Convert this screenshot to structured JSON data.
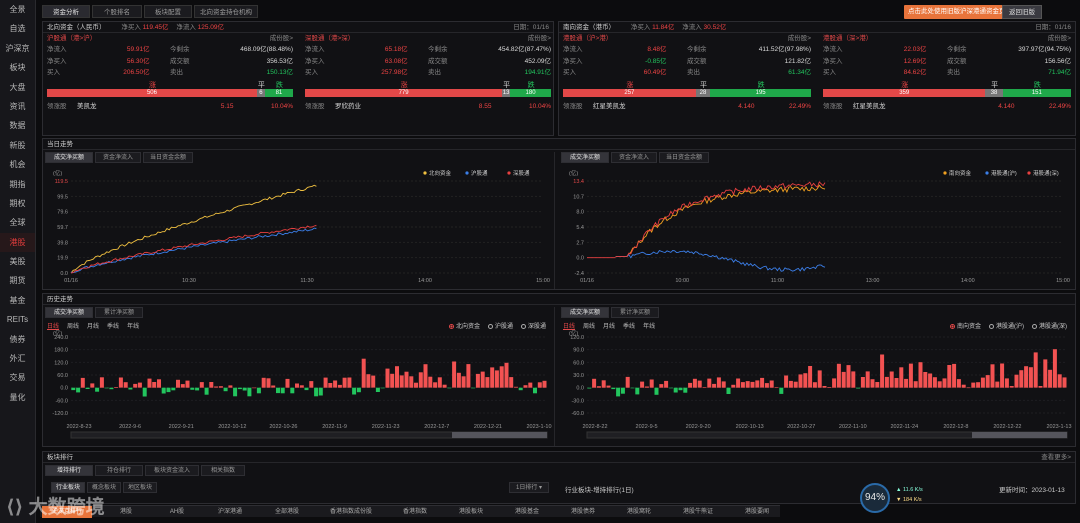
{
  "sidebar": [
    "全景",
    "自选",
    "沪深京",
    "板块",
    "大盘",
    "资讯",
    "数据",
    "新股",
    "机会",
    "期指",
    "期权",
    "全球",
    "港股",
    "美股",
    "期货",
    "基金",
    "REITs",
    "债券",
    "外汇",
    "交易",
    "量化"
  ],
  "sidebar_active": 12,
  "top_tabs": [
    "资金分析",
    "个股排名",
    "板块配置",
    "北向资金持仓机构"
  ],
  "promo": "点击此处使用旧版沪深港通资金页 ×",
  "back": "返回旧版",
  "north": {
    "title": "北向资金（人民币）",
    "net_buy_label": "净买入",
    "net_buy": "119.45亿",
    "net_flow_label": "净流入",
    "net_flow": "125.09亿",
    "date": "日期：01/16",
    "sh": {
      "name": "沪股通（港>沪）",
      "unit": "成份股>",
      "rows": [
        [
          "净流入",
          "59.91亿",
          "今剩余",
          "468.09亿(88.48%)"
        ],
        [
          "净买入",
          "56.30亿",
          "成交额",
          "356.53亿"
        ],
        [
          "买入",
          "206.50亿",
          "卖出",
          "150.13亿"
        ]
      ],
      "up_label": "涨",
      "flat_label": "平",
      "down_label": "跌",
      "up": "506",
      "flat": "6",
      "down": "81",
      "lead_label": "领涨股",
      "lead": "美凯龙",
      "price": "5.15",
      "pct": "10.04%"
    },
    "sz": {
      "name": "深股通（港>深）",
      "unit": "成份股>",
      "rows": [
        [
          "净流入",
          "65.18亿",
          "今剩余",
          "454.82亿(87.47%)"
        ],
        [
          "净买入",
          "63.08亿",
          "成交额",
          "452.09亿"
        ],
        [
          "买入",
          "257.98亿",
          "卖出",
          "194.91亿"
        ]
      ],
      "up_label": "涨",
      "flat_label": "平",
      "down_label": "跌",
      "up": "779",
      "flat": "13",
      "down": "180",
      "lead_label": "领涨股",
      "lead": "罗欣药业",
      "price": "8.55",
      "pct": "10.04%"
    }
  },
  "south": {
    "title": "南向资金（港币）",
    "net_buy_label": "净买入",
    "net_buy": "11.84亿",
    "net_flow_label": "净流入",
    "net_flow": "30.52亿",
    "date": "日期：01/16",
    "sh": {
      "name": "港股通（沪>港）",
      "unit": "成份股>",
      "rows": [
        [
          "净流入",
          "8.48亿",
          "今剩余",
          "411.52亿(97.98%)"
        ],
        [
          "净买入",
          "-0.85亿",
          "成交额",
          "121.82亿"
        ],
        [
          "买入",
          "60.49亿",
          "卖出",
          "61.34亿"
        ]
      ],
      "up_label": "涨",
      "flat_label": "平",
      "down_label": "跌",
      "up": "257",
      "flat": "28",
      "down": "195",
      "lead_label": "领涨股",
      "lead": "红星美凯龙",
      "price": "4.140",
      "pct": "22.49%"
    },
    "sz": {
      "name": "港股通（深>港）",
      "unit": "成份股>",
      "rows": [
        [
          "净流入",
          "22.03亿",
          "今剩余",
          "397.97亿(94.75%)"
        ],
        [
          "净买入",
          "12.69亿",
          "成交额",
          "156.56亿"
        ],
        [
          "买入",
          "84.62亿",
          "卖出",
          "71.94亿"
        ]
      ],
      "up_label": "涨",
      "flat_label": "平",
      "down_label": "跌",
      "up": "359",
      "flat": "38",
      "down": "151",
      "lead_label": "领涨股",
      "lead": "红星美凯龙",
      "price": "4.140",
      "pct": "22.49%"
    }
  },
  "intraday": {
    "title": "当日走势",
    "tabs": [
      "成交净买额",
      "资金净流入",
      "当日资金余额"
    ],
    "left": {
      "unit": "(亿)",
      "legend": [
        "北向资金",
        "沪股通",
        "深股通"
      ],
      "colors": [
        "#f0c040",
        "#3b7ee8",
        "#e84040"
      ],
      "yticks": [
        "119.5",
        "99.5",
        "79.6",
        "59.7",
        "39.8",
        "19.9",
        "0.0"
      ],
      "xticks": [
        "01/16",
        "10:30",
        "11:30",
        "14:00",
        "15:00"
      ]
    },
    "right": {
      "unit": "(亿)",
      "legend": [
        "南向资金",
        "港股通(沪)",
        "港股通(深)"
      ],
      "colors": [
        "#f0a020",
        "#3b7ee8",
        "#e84040"
      ],
      "yticks": [
        "13.4",
        "10.7",
        "8.0",
        "5.4",
        "2.7",
        "0.0",
        "-2.4"
      ],
      "xticks": [
        "01/16",
        "10:00",
        "11:00",
        "13:00",
        "14:00",
        "15:00"
      ]
    }
  },
  "history": {
    "title": "历史走势",
    "tabs": [
      "成交净买额",
      "累计净买额"
    ],
    "periods": [
      "日线",
      "周线",
      "月线",
      "季线",
      "年线"
    ],
    "left": {
      "unit": "(亿)",
      "radios": [
        "北向资金",
        "沪股通",
        "深股通"
      ],
      "yticks": [
        "240.0",
        "180.0",
        "120.0",
        "60.0",
        "0.0",
        "-60.0",
        "-120.0"
      ],
      "xticks": [
        "2022-8-23",
        "2022-9-6",
        "2022-9-21",
        "2022-10-12",
        "2022-10-26",
        "2022-11-9",
        "2022-11-23",
        "2022-12-7",
        "2022-12-21",
        "2023-1-10"
      ]
    },
    "right": {
      "unit": "(亿)",
      "radios": [
        "南向资金",
        "港股通(沪)",
        "港股通(深)"
      ],
      "yticks": [
        "120.0",
        "90.0",
        "60.0",
        "30.0",
        "0.0",
        "-30.0",
        "-60.0"
      ],
      "xticks": [
        "2022-8-22",
        "2022-9-5",
        "2022-9-20",
        "2022-10-13",
        "2022-10-27",
        "2022-11-10",
        "2022-11-24",
        "2022-12-8",
        "2022-12-22",
        "2023-1-13"
      ]
    }
  },
  "board": {
    "title": "板块排行",
    "more": "查看更多>",
    "tabs": [
      "增持排行",
      "持仓排行",
      "板块资金流入",
      "相关指数"
    ],
    "subtabs": [
      "行业板块",
      "概念板块",
      "地区板块"
    ],
    "select": "1日排行",
    "right_title": "行业板块-增持排行(1日)",
    "update": "更新时间：2023-01-13"
  },
  "bottom_nav": [
    "沪深京排行",
    "港股",
    "AH股",
    "沪深港通",
    "全部港股",
    "香港指数成份股",
    "香港指数",
    "港股板块",
    "港股基金",
    "港股债券",
    "港股窝轮",
    "港股牛熊证",
    "港股要闻"
  ],
  "score": "94%",
  "speed1": "11.6 K/s",
  "speed2": "184 K/s",
  "watermark": "大数跨境"
}
